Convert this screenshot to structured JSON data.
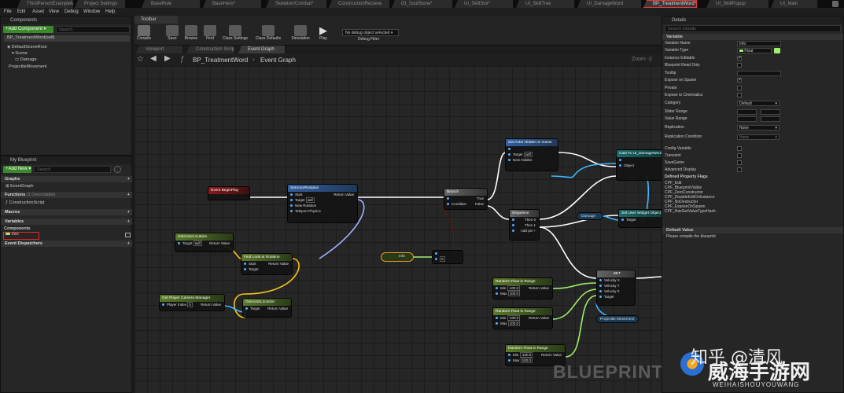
{
  "tabs": [
    "ThirdPersonExampleMap*",
    "Project Settings",
    "BaseRole",
    "BaseHero*",
    "Skeleton/Combat*",
    "ConstructionRecieve",
    "GI_SoulStone*",
    "UI_SkillSlot*",
    "UI_SkillTree",
    "UI_DamageWord",
    "BP_TreatmentWord*",
    "UI_SkillPopup",
    "UI_Main"
  ],
  "menu": [
    "File",
    "Edit",
    "Asset",
    "View",
    "Debug",
    "Window",
    "Help"
  ],
  "components": {
    "title": "Components",
    "add_button": "+Add Component ▾",
    "search_placeholder": "Search",
    "self_label": "BP_TreatmentWord(self)",
    "tree": [
      "DefaultSceneRoot",
      "Scene",
      "Damage",
      "ProjectileMovement"
    ]
  },
  "toolbar": {
    "title": "Toolbar",
    "buttons": [
      "Compile",
      "Save",
      "Browse",
      "Find",
      "Class Settings",
      "Class Defaults",
      "Simulation",
      "Play"
    ],
    "debug_select": "No debug object selected ▾",
    "debug_filter": "Debug Filter"
  },
  "editor_tabs": [
    "Viewport",
    "Construction Script",
    "Event Graph"
  ],
  "breadcrumb": {
    "root": "BP_TreatmentWord",
    "sep": "›",
    "leaf": "Event Graph",
    "zoom": "Zoom -2"
  },
  "my_blueprint": {
    "title": "My Blueprint",
    "add_new": "+Add New ▾",
    "search_placeholder": "Search",
    "sections": {
      "graphs": "Graphs",
      "event_graph": "EventGraph",
      "functions": "Functions",
      "functions_note": "(1 Overridable)",
      "construction_script": "ConstructionScript",
      "macros": "Macros",
      "variables": "Variables",
      "components": "Components",
      "info_var": "Info",
      "dispatchers": "Event Dispatchers"
    }
  },
  "nodes": {
    "event_begin": "Event BeginPlay",
    "set_rot": "SetActorRotation",
    "set_rot_sub": "Target is Actor",
    "branch": "Branch",
    "set_hidden": "Set Actor Hidden In Game",
    "set_hidden_sub": "Target is Actor",
    "cast": "Cast To UI_DamageWord",
    "sequence": "Sequence",
    "set_widget": "Set User Widget Object",
    "damage": "Damage",
    "get_loc1": "GetActorLocation",
    "get_loc_sub": "Target is Actor",
    "find_look": "Find Look at Rotation",
    "get_cam": "Get Player Camera Manager",
    "get_loc2": "GetActorLocation",
    "info": "Info",
    "rand1": "Random Float in Range",
    "rand2": "Random Float in Range",
    "rand3": "Random Float in Range",
    "set_vel": "SET",
    "proj": "Projectile Movement",
    "pins": {
      "start": "Start",
      "target": "Target",
      "new_rotation": "New Rotation",
      "teleport": "Teleport Physics",
      "return_value": "Return Value",
      "condition": "Condition",
      "true": "True",
      "false": "False",
      "new_hidden": "New Hidden",
      "object": "Object",
      "then0": "Then 0",
      "then1": "Then 1",
      "add_pin": "Add pin +",
      "min": "Min",
      "max": "Max",
      "velocity_x": "Velocity X",
      "velocity_y": "Velocity Y",
      "velocity_z": "Velocity Z",
      "player_index": "Player Index",
      "self": "self",
      "zero": "0",
      "min_val": "-100.0",
      "max_val": "100.0"
    }
  },
  "details": {
    "title": "Details",
    "search_placeholder": "Search Details",
    "variable_header": "Variable",
    "rows": [
      {
        "label": "Variable Name",
        "value": "Info",
        "kind": "text"
      },
      {
        "label": "Variable Type",
        "value": "Float",
        "kind": "type"
      },
      {
        "label": "Instance Editable",
        "kind": "check",
        "on": true
      },
      {
        "label": "Blueprint Read Only",
        "kind": "check",
        "on": false
      },
      {
        "label": "Tooltip",
        "value": "",
        "kind": "text"
      },
      {
        "label": "Expose on Spawn",
        "kind": "check",
        "on": true
      },
      {
        "label": "Private",
        "kind": "check",
        "on": false
      },
      {
        "label": "Expose to Cinematics",
        "kind": "check",
        "on": false
      },
      {
        "label": "Category",
        "value": "Default",
        "kind": "select"
      },
      {
        "label": "Slider Range",
        "kind": "range"
      },
      {
        "label": "Value Range",
        "kind": "range"
      },
      {
        "label": "Replication",
        "value": "None",
        "kind": "select"
      },
      {
        "label": "Replication Condition",
        "value": "None",
        "kind": "select"
      }
    ],
    "flags": [
      {
        "label": "Config Variable",
        "on": false
      },
      {
        "label": "Transient",
        "on": false
      },
      {
        "label": "SaveGame",
        "on": false
      },
      {
        "label": "Advanced Display",
        "on": false
      }
    ],
    "property_flags_title": "Defined Property Flags",
    "property_flags": [
      "CPF_Edit",
      "CPF_BlueprintVisible",
      "CPF_ZeroConstructor",
      "CPF_DisableEditOnInstance",
      "CPF_NoDestructor",
      "CPF_ExposeOnSpawn",
      "CPF_HasGetValueTypeHash"
    ],
    "default_value_header": "Default Value",
    "default_value_note": "Please compile the blueprint"
  },
  "watermark": {
    "blueprint": "BLUEPRINT",
    "zhihu": "知乎 @清风",
    "site": "威海手游网",
    "site_sub": "WEIHAISHOUYOUWANG"
  },
  "colors": {
    "exec": "#ffffff",
    "float": "#9ef06a",
    "object": "#3db7ff",
    "vector": "#f5c518",
    "rotator": "#9fb2ff",
    "bool": "#a80000"
  }
}
